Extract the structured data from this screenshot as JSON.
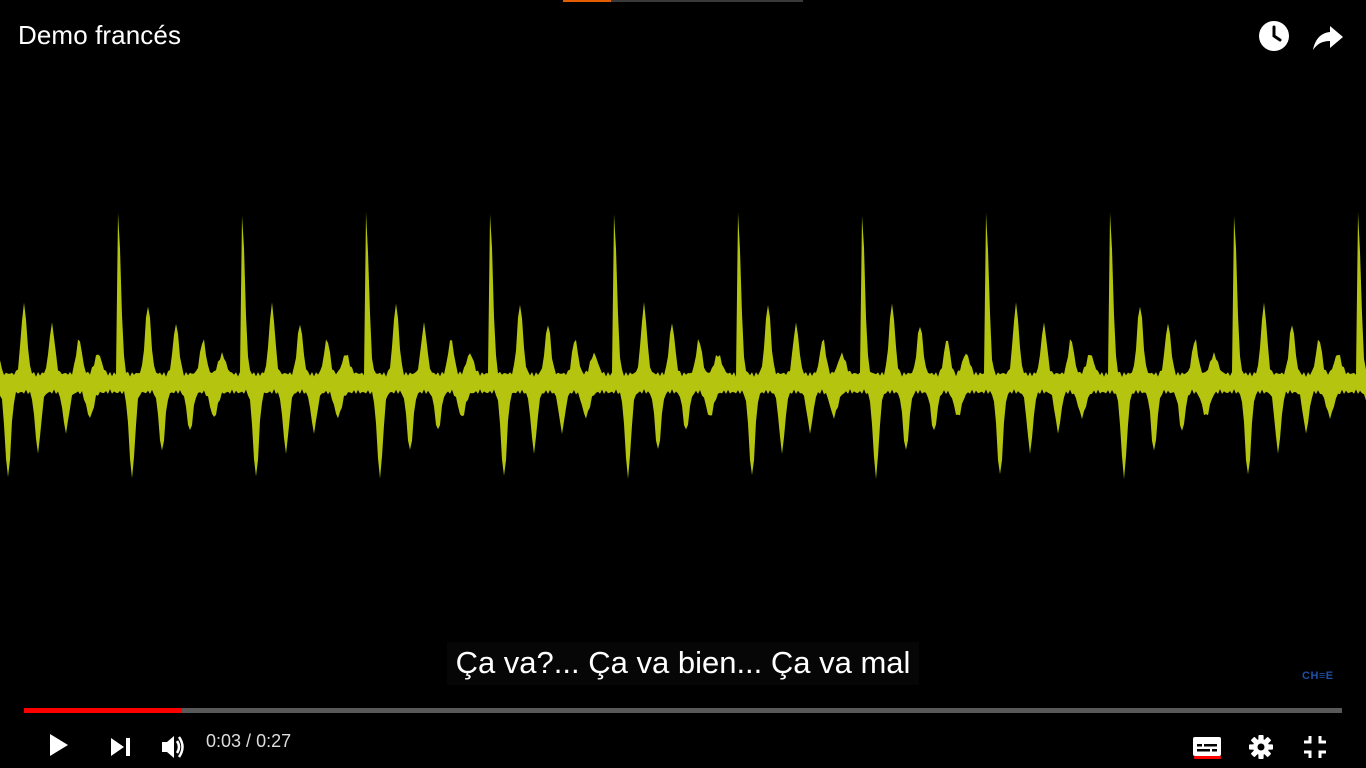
{
  "player": {
    "title": "Demo francés",
    "subtitle": "Ça va?... Ça va bien... Ça va mal",
    "watermark": "CH≡E",
    "time": {
      "current": "0:03",
      "duration": "0:27",
      "separator": " / "
    },
    "progress_fraction": 0.12,
    "captions_enabled": true
  },
  "icons": {
    "watch_later": "clock-icon",
    "share": "share-arrow-icon",
    "play": "play-icon",
    "next": "skip-next-icon",
    "volume": "volume-icon",
    "captions": "captions-icon",
    "settings": "gear-icon",
    "exit_fullscreen": "exit-fullscreen-icon"
  },
  "colors": {
    "waveform": "#b5c40e",
    "progress_played": "#ff0000",
    "background": "#000000"
  }
}
